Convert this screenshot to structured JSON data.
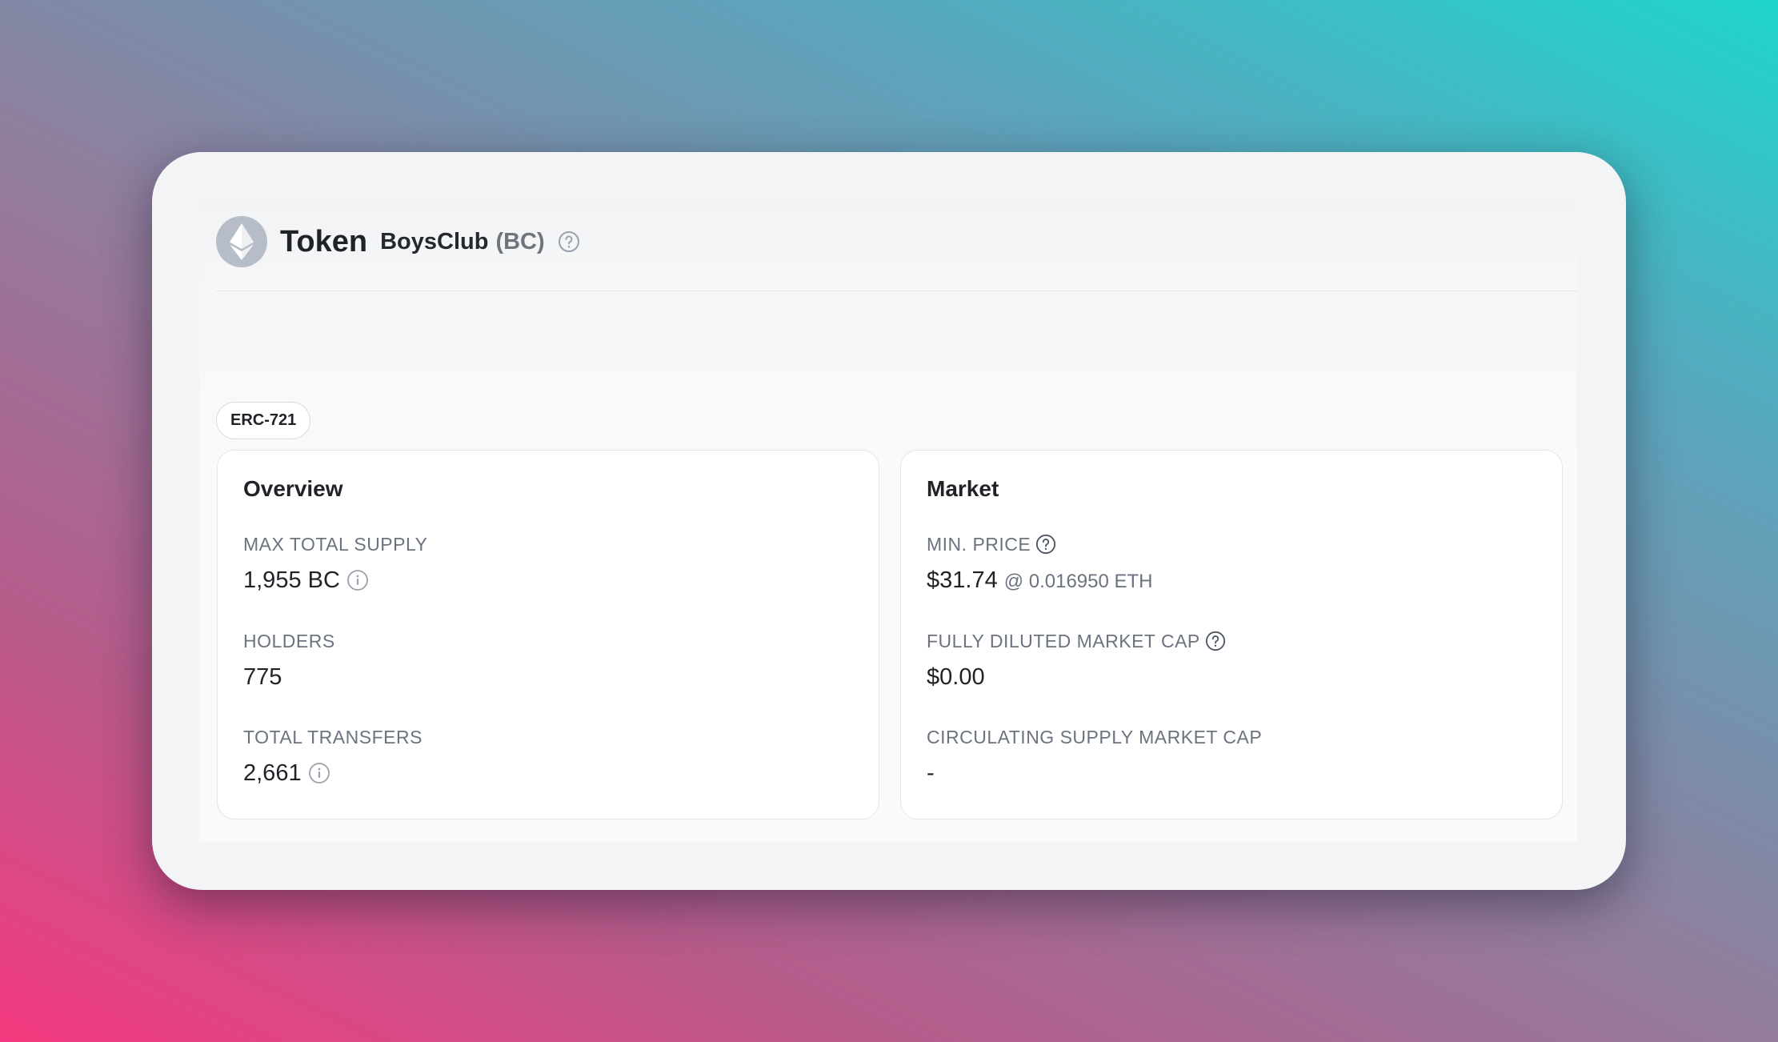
{
  "header": {
    "title": "Token",
    "token_name": "BoysClub",
    "token_symbol": "(BC)",
    "logo_icon": "ethereum-icon",
    "help_icon": "question-circle-icon"
  },
  "badge": {
    "label": "ERC-721"
  },
  "overview": {
    "title": "Overview",
    "max_total_supply": {
      "label": "MAX TOTAL SUPPLY",
      "value": "1,955 BC",
      "icon": "info-icon"
    },
    "holders": {
      "label": "HOLDERS",
      "value": "775"
    },
    "total_transfers": {
      "label": "TOTAL TRANSFERS",
      "value": "2,661",
      "icon": "info-icon"
    }
  },
  "market": {
    "title": "Market",
    "min_price": {
      "label": "MIN. PRICE",
      "value": "$31.74",
      "sub": "@ 0.016950 ETH",
      "icon": "question-circle-icon"
    },
    "fully_diluted": {
      "label": "FULLY DILUTED MARKET CAP",
      "value": "$0.00",
      "icon": "question-circle-icon"
    },
    "circulating": {
      "label": "CIRCULATING SUPPLY MARKET CAP",
      "value": "-"
    }
  },
  "colors": {
    "text": "#1f2328",
    "muted": "#6b7280",
    "logo_bg": "#b6bdc8"
  }
}
